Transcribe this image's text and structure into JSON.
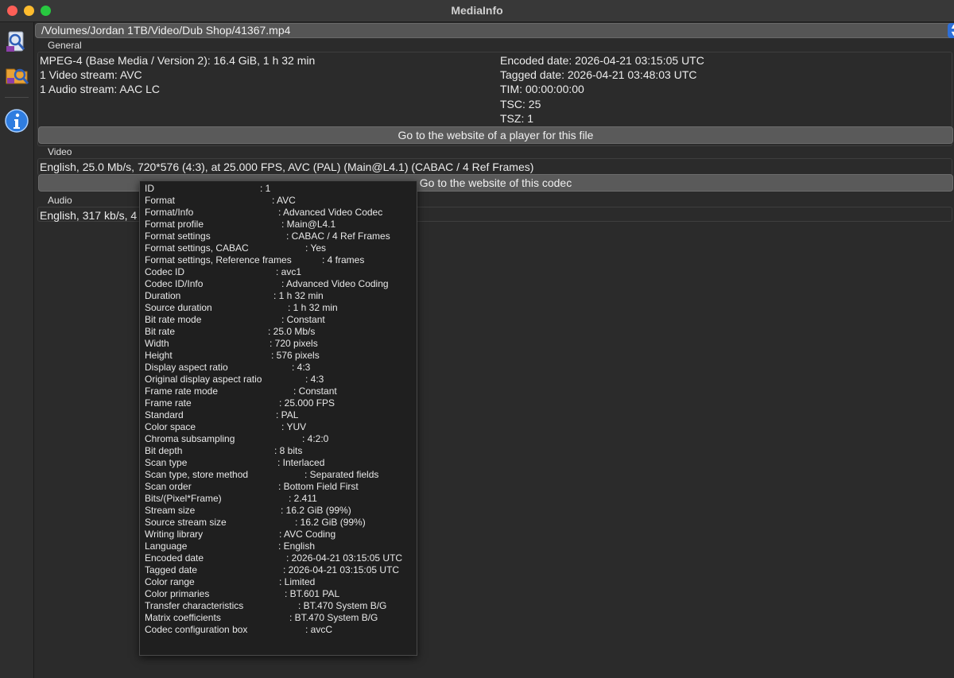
{
  "window": {
    "title": "MediaInfo"
  },
  "sidebar": {
    "icons": [
      "open-file-icon",
      "open-folder-icon",
      "info-icon"
    ]
  },
  "file_path": "/Volumes/Jordan 1TB/Video/Dub Shop/41367.mp4",
  "general": {
    "label": "General",
    "left_lines": [
      "MPEG-4 (Base Media / Version 2): 16.4 GiB, 1 h 32 min",
      "1 Video stream: AVC",
      "1 Audio stream: AAC LC"
    ],
    "right_lines": [
      "Encoded date: 2026-04-21 03:15:05 UTC",
      "Tagged date: 2026-04-21 03:48:03 UTC",
      "TIM: 00:00:00:00",
      "TSC: 25",
      "TSZ: 1"
    ],
    "button": "Go to the website of a player for this file"
  },
  "video": {
    "label": "Video",
    "line": "English, 25.0 Mb/s, 720*576 (4:3), at 25.000 FPS, AVC (PAL) (Main@L4.1) (CABAC / 4 Ref Frames)",
    "button": "Go to the website of this codec"
  },
  "audio": {
    "label": "Audio",
    "line": "English, 317 kb/s, 4"
  },
  "tooltip": {
    "rows": [
      {
        "label": "ID",
        "value": ": 1"
      },
      {
        "label": "Format",
        "value": ": AVC"
      },
      {
        "label": "Format/Info",
        "value": ": Advanced Video Codec"
      },
      {
        "label": "Format profile",
        "value": ": Main@L4.1"
      },
      {
        "label": "Format settings",
        "value": ": CABAC / 4 Ref Frames"
      },
      {
        "label": "Format settings, CABAC",
        "value": ": Yes"
      },
      {
        "label": "Format settings, Reference frames",
        "value": ": 4 frames"
      },
      {
        "label": "Codec ID",
        "value": ": avc1"
      },
      {
        "label": "Codec ID/Info",
        "value": ": Advanced Video Coding"
      },
      {
        "label": "Duration",
        "value": ": 1 h 32 min"
      },
      {
        "label": "Source duration",
        "value": ": 1 h 32 min"
      },
      {
        "label": "Bit rate mode",
        "value": ": Constant"
      },
      {
        "label": "Bit rate",
        "value": ": 25.0 Mb/s"
      },
      {
        "label": "Width",
        "value": ": 720 pixels"
      },
      {
        "label": "Height",
        "value": ": 576 pixels"
      },
      {
        "label": "Display aspect ratio",
        "value": ": 4:3"
      },
      {
        "label": "Original display aspect ratio",
        "value": ": 4:3"
      },
      {
        "label": "Frame rate mode",
        "value": ": Constant"
      },
      {
        "label": "Frame rate",
        "value": ": 25.000 FPS"
      },
      {
        "label": "Standard",
        "value": ": PAL"
      },
      {
        "label": "Color space",
        "value": ": YUV"
      },
      {
        "label": "Chroma subsampling",
        "value": ": 4:2:0"
      },
      {
        "label": "Bit depth",
        "value": ": 8 bits"
      },
      {
        "label": "Scan type",
        "value": ": Interlaced"
      },
      {
        "label": "Scan type, store method",
        "value": ": Separated fields"
      },
      {
        "label": "Scan order",
        "value": ": Bottom Field First"
      },
      {
        "label": "Bits/(Pixel*Frame)",
        "value": ": 2.411"
      },
      {
        "label": "Stream size",
        "value": ": 16.2 GiB (99%)"
      },
      {
        "label": "Source stream size",
        "value": ": 16.2 GiB (99%)"
      },
      {
        "label": "Writing library",
        "value": ": AVC Coding"
      },
      {
        "label": "Language",
        "value": ": English"
      },
      {
        "label": "Encoded date",
        "value": ": 2026-04-21 03:15:05 UTC"
      },
      {
        "label": "Tagged date",
        "value": ": 2026-04-21 03:15:05 UTC"
      },
      {
        "label": "Color range",
        "value": ": Limited"
      },
      {
        "label": "Color primaries",
        "value": ": BT.601 PAL"
      },
      {
        "label": "Transfer characteristics",
        "value": ": BT.470 System B/G"
      },
      {
        "label": "Matrix coefficients",
        "value": ": BT.470 System B/G"
      },
      {
        "label": "Codec configuration box",
        "value": ": avcC"
      }
    ]
  }
}
